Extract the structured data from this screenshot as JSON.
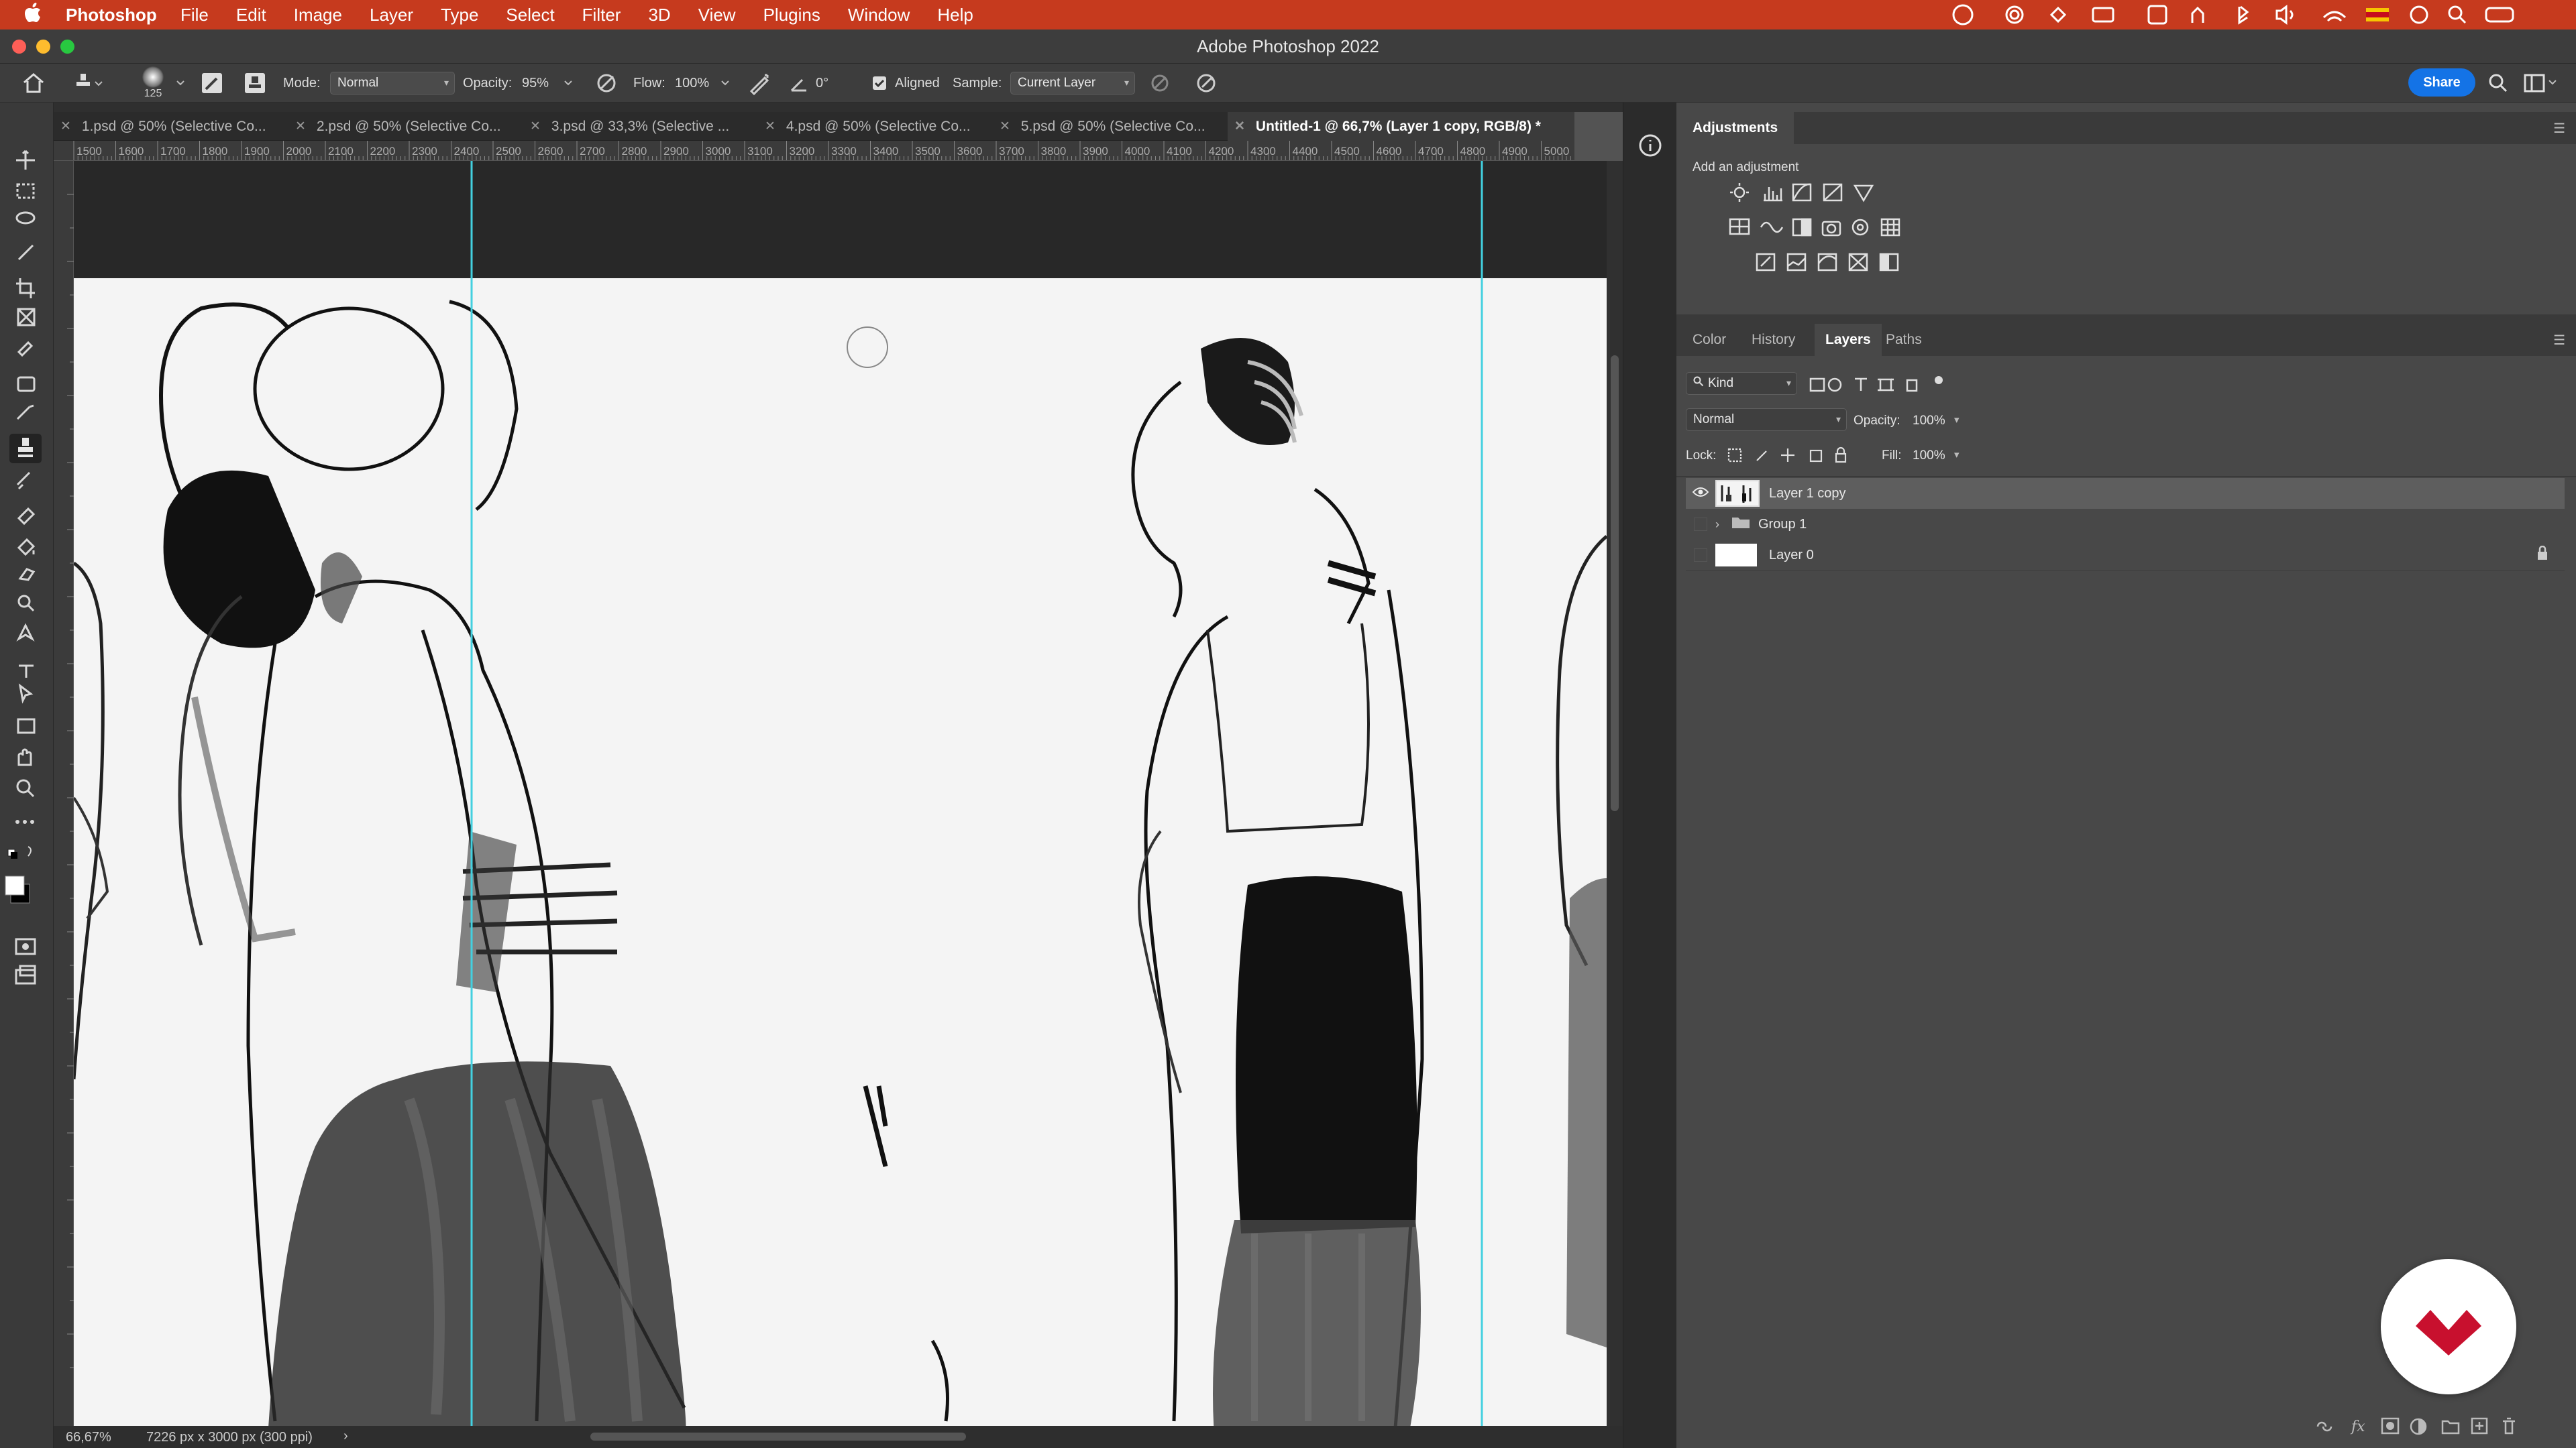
{
  "menubar": {
    "app_name": "Photoshop",
    "items": [
      "File",
      "Edit",
      "Image",
      "Layer",
      "Type",
      "Select",
      "Filter",
      "3D",
      "View",
      "Plugins",
      "Window",
      "Help"
    ]
  },
  "window": {
    "title": "Adobe Photoshop 2022"
  },
  "options": {
    "brush_size": "125",
    "mode_label": "Mode:",
    "mode_value": "Normal",
    "opacity_label": "Opacity:",
    "opacity_value": "95%",
    "flow_label": "Flow:",
    "flow_value": "100%",
    "angle_value": "0°",
    "aligned_label": "Aligned",
    "sample_label": "Sample:",
    "sample_value": "Current Layer",
    "share_label": "Share"
  },
  "tabs": [
    {
      "label": "1.psd @ 50% (Selective Co..."
    },
    {
      "label": "2.psd @ 50% (Selective Co..."
    },
    {
      "label": "3.psd @ 33,3% (Selective ..."
    },
    {
      "label": "4.psd @ 50% (Selective Co..."
    },
    {
      "label": "5.psd @ 50% (Selective Co..."
    },
    {
      "label": "Untitled-1 @ 66,7% (Layer 1 copy, RGB/8) *"
    }
  ],
  "ruler": {
    "ticks": [
      "1500",
      "1600",
      "1700",
      "1800",
      "1900",
      "2000",
      "2100",
      "2200",
      "2300",
      "2400",
      "2500",
      "2600",
      "2700",
      "2800",
      "2900",
      "3000",
      "3100",
      "3200",
      "3300",
      "3400",
      "3500",
      "3600",
      "3700",
      "3800",
      "3900",
      "4000",
      "4100",
      "4200",
      "4300",
      "4400",
      "4500",
      "4600",
      "4700",
      "4800",
      "4900",
      "5000"
    ]
  },
  "status": {
    "zoom": "66,67%",
    "doc_info": "7226 px x 3000 px (300 ppi)",
    "arrow": "›"
  },
  "adjustments": {
    "title": "Adjustments",
    "subtitle": "Add an adjustment"
  },
  "layers_panel": {
    "tabs": [
      "Color",
      "History",
      "Layers",
      "Paths"
    ],
    "active_tab": "Layers",
    "filter_label": "Kind",
    "blend_mode": "Normal",
    "opacity_label": "Opacity:",
    "opacity_value": "100%",
    "lock_label": "Lock:",
    "fill_label": "Fill:",
    "fill_value": "100%",
    "layers": [
      {
        "name": "Layer 1 copy",
        "visible": true,
        "selected": true
      },
      {
        "name": "Group 1",
        "visible": false,
        "selected": false
      },
      {
        "name": "Layer 0",
        "visible": false,
        "selected": false,
        "locked": true
      }
    ]
  },
  "colors": {
    "menubar": "#c63a1e",
    "accent": "#1473e6",
    "guide": "#43d0e0",
    "logo": "#c8102e"
  }
}
